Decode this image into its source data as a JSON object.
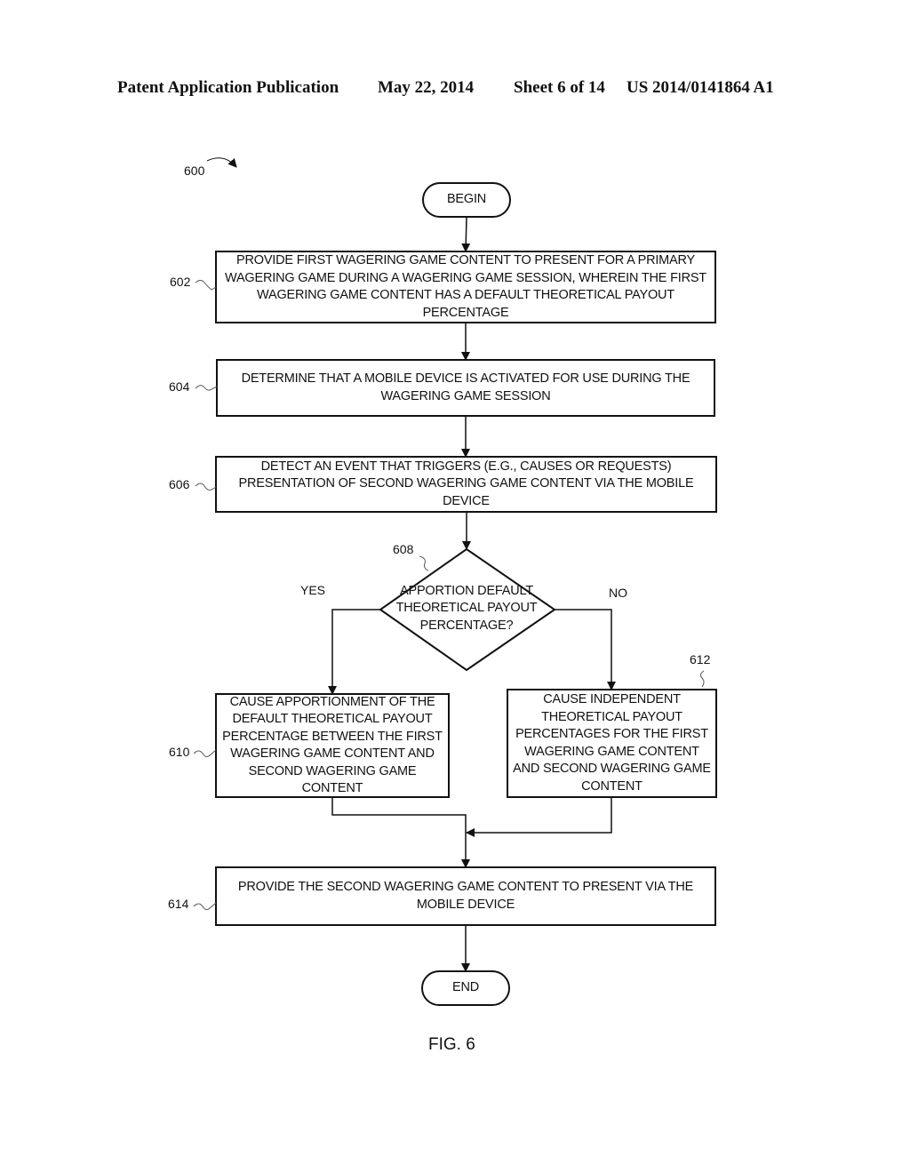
{
  "header": {
    "publication": "Patent Application Publication",
    "date": "May 22, 2014",
    "sheet": "Sheet 6 of 14",
    "number": "US 2014/0141864 A1"
  },
  "figure": {
    "ref": "600",
    "caption": "FIG. 6",
    "begin": "BEGIN",
    "end": "END",
    "steps": [
      {
        "ref": "602",
        "text": "PROVIDE FIRST WAGERING GAME CONTENT TO PRESENT FOR A PRIMARY WAGERING GAME DURING A WAGERING GAME SESSION, WHEREIN THE FIRST WAGERING GAME CONTENT HAS A DEFAULT THEORETICAL PAYOUT PERCENTAGE"
      },
      {
        "ref": "604",
        "text": "DETERMINE THAT A MOBILE DEVICE IS ACTIVATED FOR USE DURING THE WAGERING GAME SESSION"
      },
      {
        "ref": "606",
        "text": "DETECT AN EVENT THAT TRIGGERS (E.G., CAUSES OR REQUESTS) PRESENTATION OF SECOND WAGERING GAME CONTENT VIA THE MOBILE DEVICE"
      },
      {
        "ref": "608",
        "text": "APPORTION DEFAULT THEORETICAL PAYOUT PERCENTAGE?"
      },
      {
        "ref": "610",
        "text": "CAUSE APPORTIONMENT OF THE DEFAULT THEORETICAL PAYOUT PERCENTAGE BETWEEN THE FIRST WAGERING GAME CONTENT AND SECOND WAGERING GAME CONTENT"
      },
      {
        "ref": "612",
        "text": "CAUSE INDEPENDENT THEORETICAL PAYOUT PERCENTAGES FOR THE FIRST WAGERING GAME CONTENT AND SECOND WAGERING GAME CONTENT"
      },
      {
        "ref": "614",
        "text": "PROVIDE THE SECOND WAGERING GAME CONTENT TO PRESENT VIA THE MOBILE DEVICE"
      }
    ],
    "yes_label": "YES",
    "no_label": "NO"
  }
}
